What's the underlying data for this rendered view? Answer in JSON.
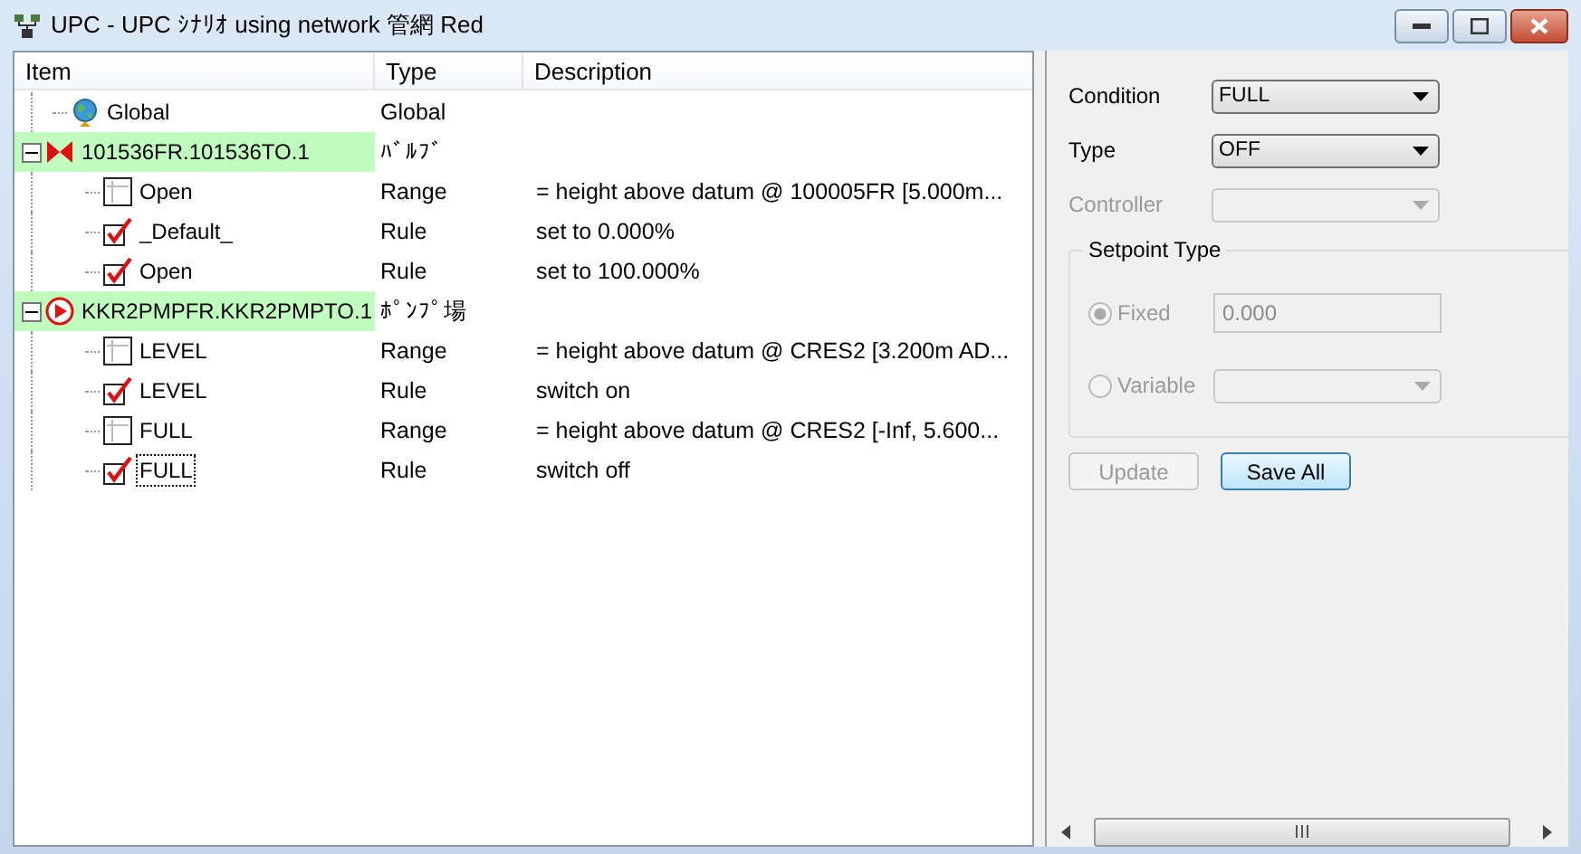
{
  "window": {
    "title": "UPC - UPC ｼﾅﾘｵ using network 管網 Red"
  },
  "tree": {
    "columns": [
      "Item",
      "Type",
      "Description"
    ],
    "items": [
      {
        "kind": "global",
        "label": "Global",
        "type": "Global",
        "selected": false
      },
      {
        "kind": "valve",
        "label": "101536FR.101536TO.1",
        "type": "ﾊﾞﾙﾌﾞ",
        "expanded": true,
        "highlighted": true,
        "selected": false,
        "children": [
          {
            "kind": "range",
            "label": "Open",
            "type": "Range",
            "description": "= height above datum @ 100005FR [5.000m...",
            "selected": false
          },
          {
            "kind": "rule",
            "label": "_Default_",
            "type": "Rule",
            "description": "set to 0.000%",
            "selected": false
          },
          {
            "kind": "rule",
            "label": "Open",
            "type": "Rule",
            "description": "set to 100.000%",
            "selected": false
          }
        ]
      },
      {
        "kind": "pump",
        "label": "KKR2PMPFR.KKR2PMPTO.1",
        "type": "ﾎﾟﾝﾌﾟ場",
        "expanded": true,
        "highlighted": true,
        "selected": false,
        "children": [
          {
            "kind": "range",
            "label": "LEVEL",
            "type": "Range",
            "description": "= height above datum @ CRES2 [3.200m AD...",
            "selected": false
          },
          {
            "kind": "rule",
            "label": "LEVEL",
            "type": "Rule",
            "description": "switch on",
            "selected": false
          },
          {
            "kind": "range",
            "label": "FULL",
            "type": "Range",
            "description": "= height above datum @ CRES2 [-Inf, 5.600...",
            "selected": false
          },
          {
            "kind": "rule",
            "label": "FULL",
            "type": "Rule",
            "description": "switch off",
            "selected": true
          }
        ]
      }
    ]
  },
  "form": {
    "fields": [
      {
        "label": "Condition",
        "value": "FULL",
        "disabled": false
      },
      {
        "label": "Type",
        "value": "OFF",
        "disabled": false
      },
      {
        "label": "Controller",
        "disabled": true
      }
    ],
    "setpoint": {
      "title": "Setpoint Type",
      "options": [
        {
          "label": "Fixed",
          "kind": "text",
          "value": "0.000",
          "selected": true,
          "disabled": true
        },
        {
          "label": "Variable",
          "kind": "select",
          "selected": false,
          "disabled": true
        }
      ]
    },
    "buttons": [
      {
        "label": "Update",
        "disabled": true,
        "default": false
      },
      {
        "label": "Save All",
        "disabled": false,
        "default": true
      }
    ]
  }
}
